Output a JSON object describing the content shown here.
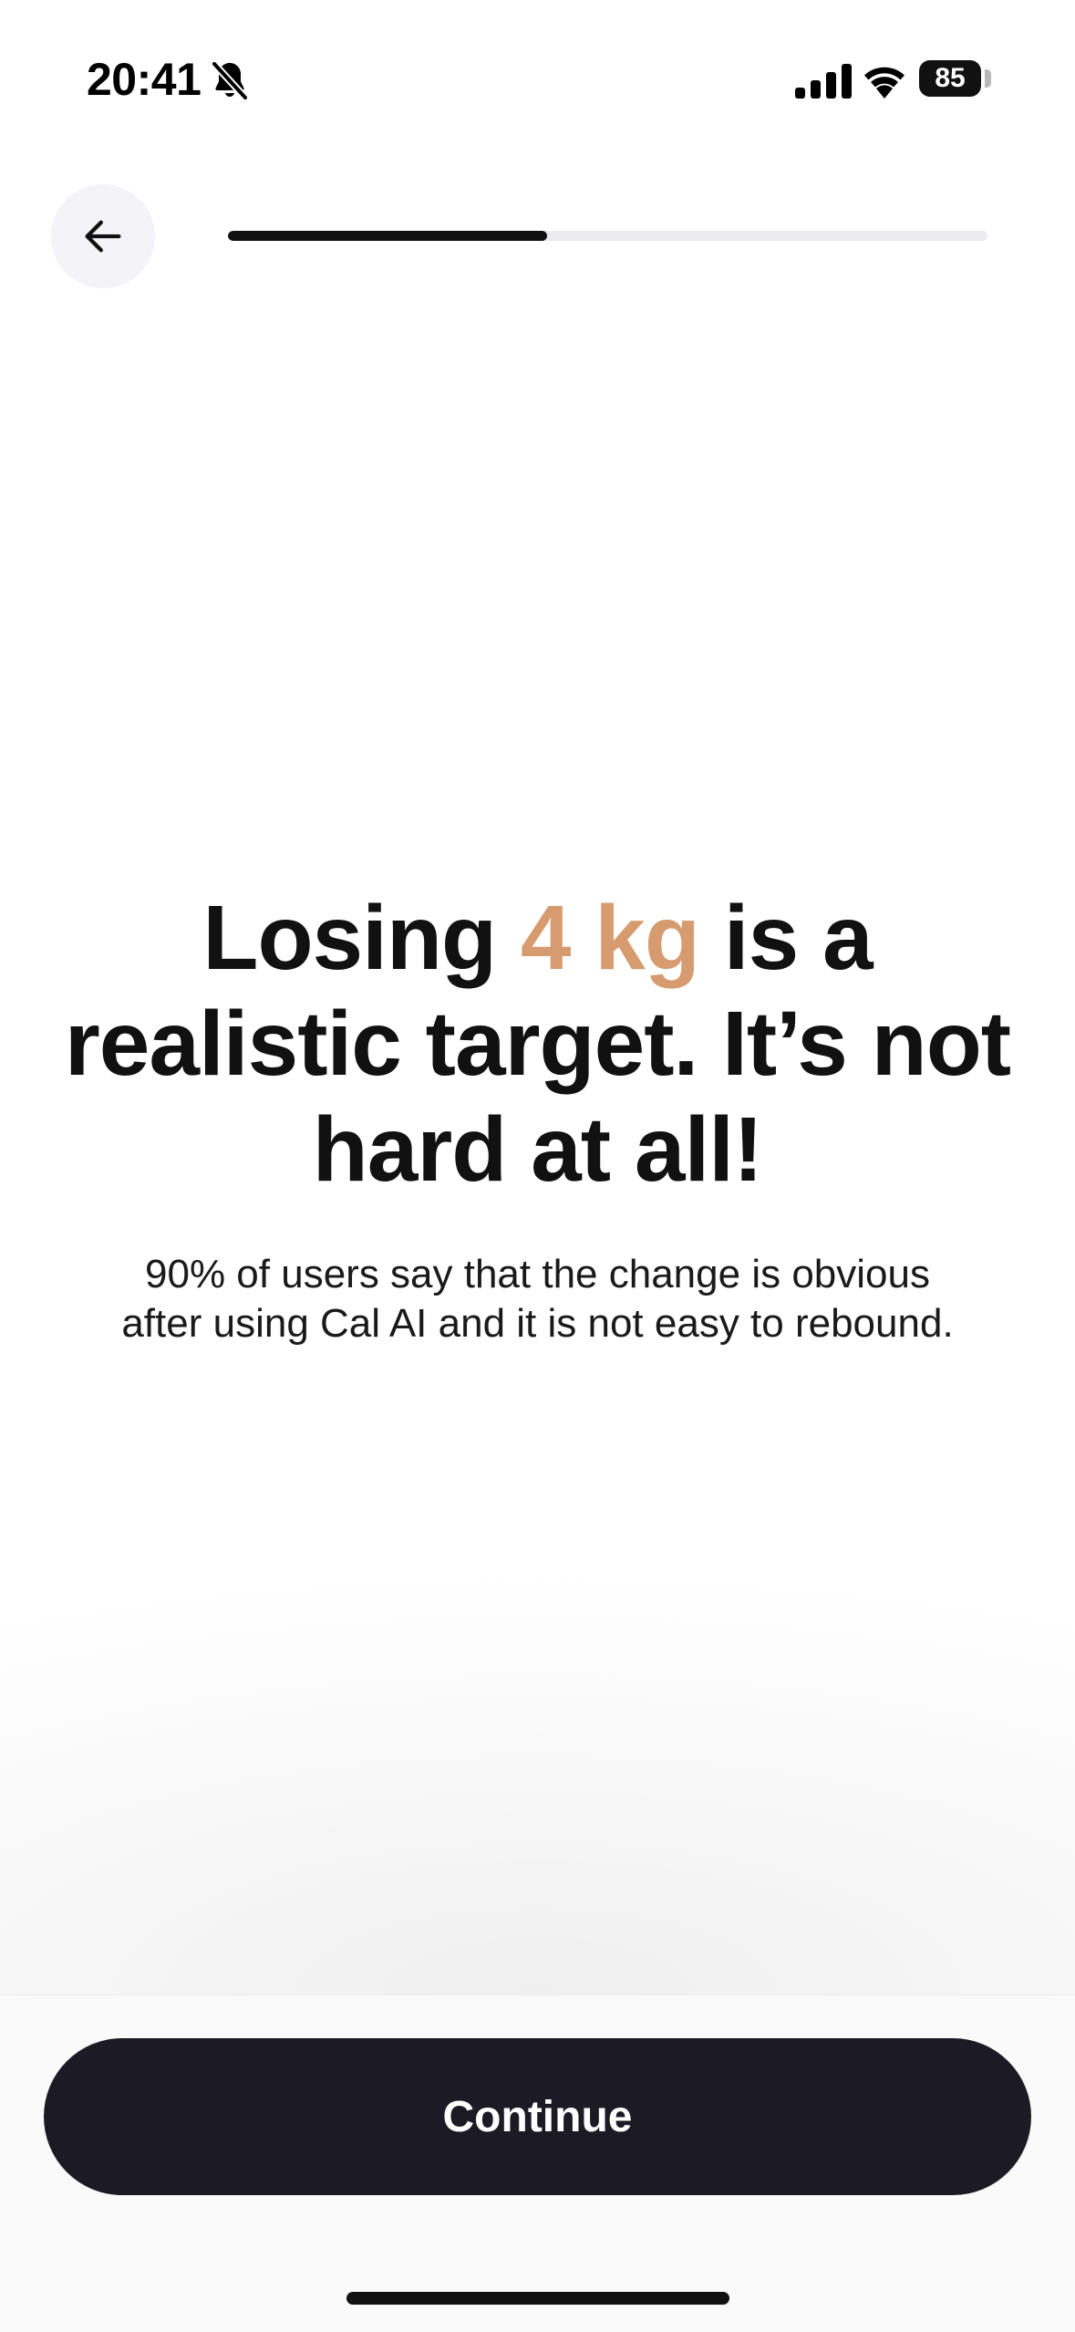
{
  "status_bar": {
    "time": "20:41",
    "battery": "85",
    "icons": [
      "bell-slash-icon",
      "cellular-signal-icon",
      "wifi-icon",
      "battery-icon"
    ]
  },
  "header": {
    "back_icon": "arrow-left-icon",
    "progress": 0.42
  },
  "main": {
    "headline_pre": "Losing ",
    "headline_highlight": "4 kg",
    "headline_post": " is a realistic target. It’s not hard at all!",
    "subtext": "90% of users say that the change is obvious after using Cal AI and it is not easy to rebound."
  },
  "footer": {
    "continue_label": "Continue"
  },
  "colors": {
    "accent": "#d69b6e",
    "button": "#1c1a24",
    "text": "#111111",
    "progress_track": "#ececee"
  }
}
